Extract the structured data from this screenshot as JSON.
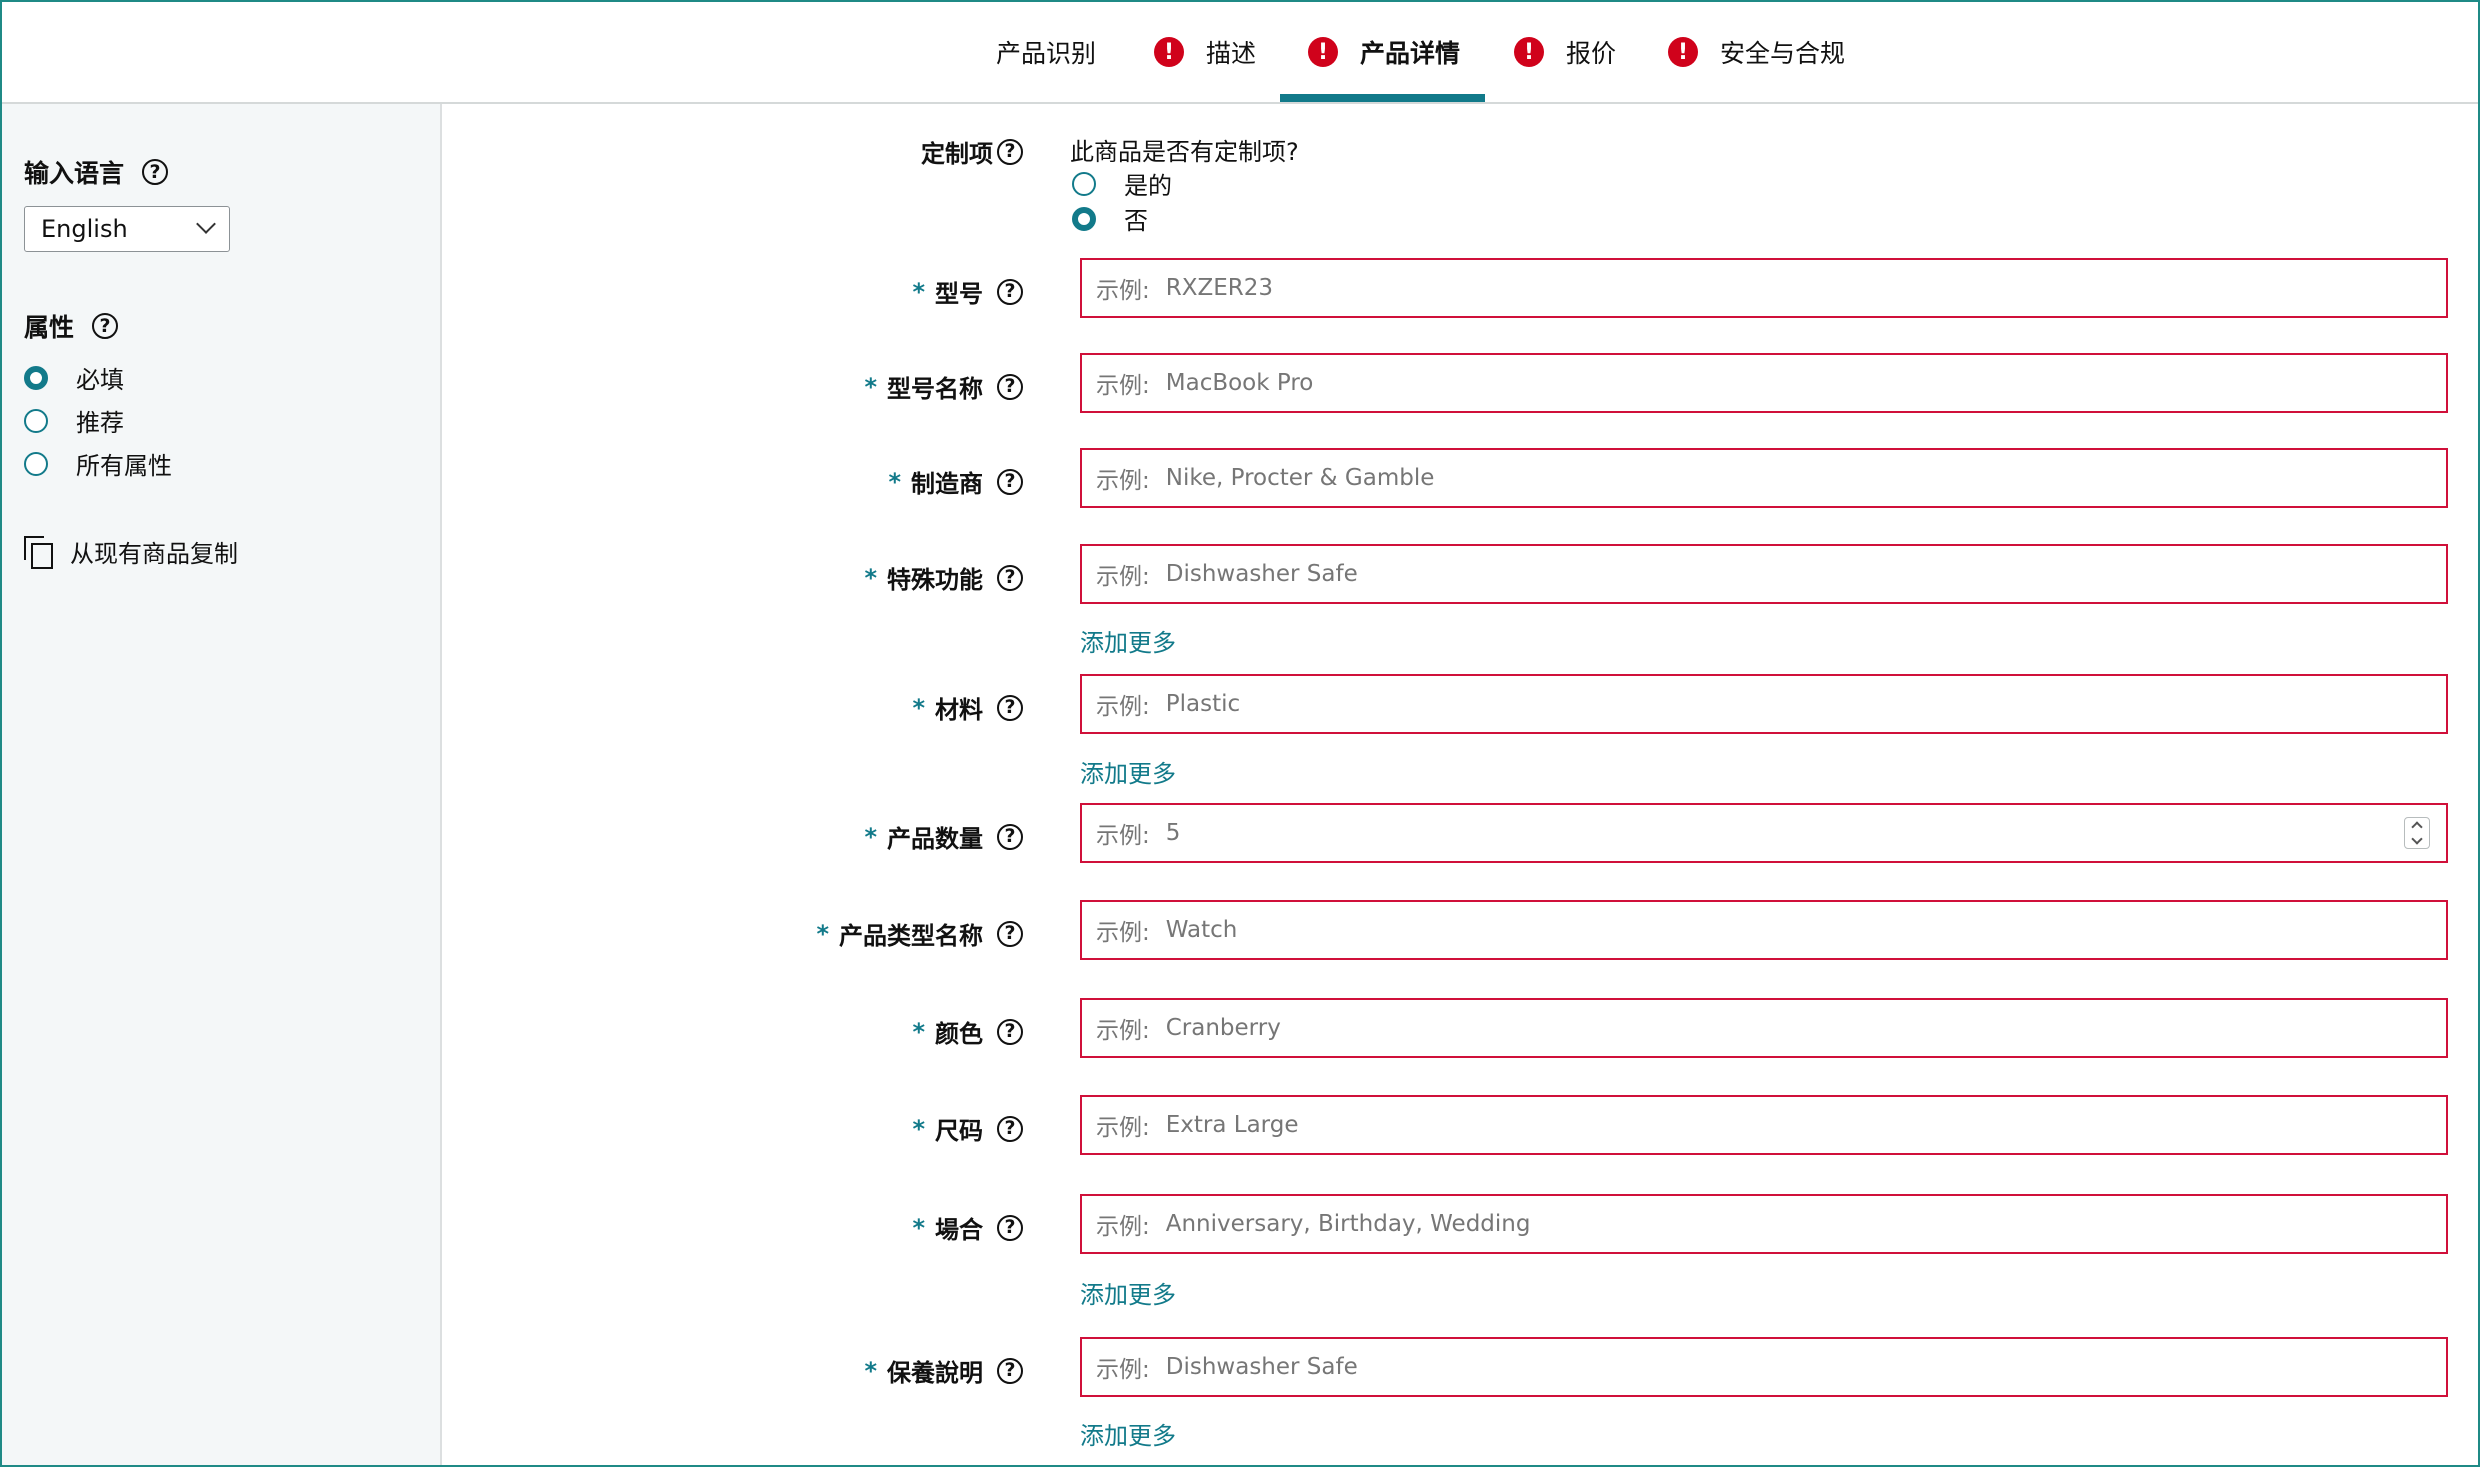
{
  "tabs": [
    {
      "label": "产品识别",
      "error": false
    },
    {
      "label": "描述",
      "error": true
    },
    {
      "label": "产品详情",
      "error": true,
      "active": true
    },
    {
      "label": "报价",
      "error": true
    },
    {
      "label": "安全与合规",
      "error": true
    }
  ],
  "sidebar": {
    "language_heading": "输入语言",
    "language_value": "English",
    "attributes_heading": "属性",
    "attribute_options": [
      {
        "label": "必填",
        "selected": true
      },
      {
        "label": "推荐",
        "selected": false
      },
      {
        "label": "所有属性",
        "selected": false
      }
    ],
    "copy_label": "从现有商品复制"
  },
  "customization": {
    "label": "定制项",
    "question": "此商品是否有定制项?",
    "options": [
      {
        "label": "是的",
        "selected": false
      },
      {
        "label": "否",
        "selected": true
      }
    ]
  },
  "form": {
    "required_mark": "*",
    "example_prefix": "示例:",
    "add_more_label": "添加更多",
    "fields": [
      {
        "label": "型号",
        "placeholder": "RXZER23"
      },
      {
        "label": "型号名称",
        "placeholder": "MacBook Pro"
      },
      {
        "label": "制造商",
        "placeholder": "Nike, Procter & Gamble"
      },
      {
        "label": "特殊功能",
        "placeholder": "Dishwasher Safe",
        "add_more": true
      },
      {
        "label": "材料",
        "placeholder": "Plastic",
        "add_more": true
      },
      {
        "label": "产品数量",
        "placeholder": "5",
        "numeric": true
      },
      {
        "label": "产品类型名称",
        "placeholder": "Watch"
      },
      {
        "label": "颜色",
        "placeholder": "Cranberry"
      },
      {
        "label": "尺码",
        "placeholder": "Extra Large"
      },
      {
        "label": "場合",
        "placeholder": "Anniversary, Birthday, Wedding",
        "add_more": true
      },
      {
        "label": "保養說明",
        "placeholder": "Dishwasher Safe",
        "add_more": true
      }
    ]
  },
  "colors": {
    "accent": "#127a8a",
    "error": "#d0021b",
    "field_border_error": "#d0103a",
    "sidebar_bg": "#f4f7f8"
  }
}
